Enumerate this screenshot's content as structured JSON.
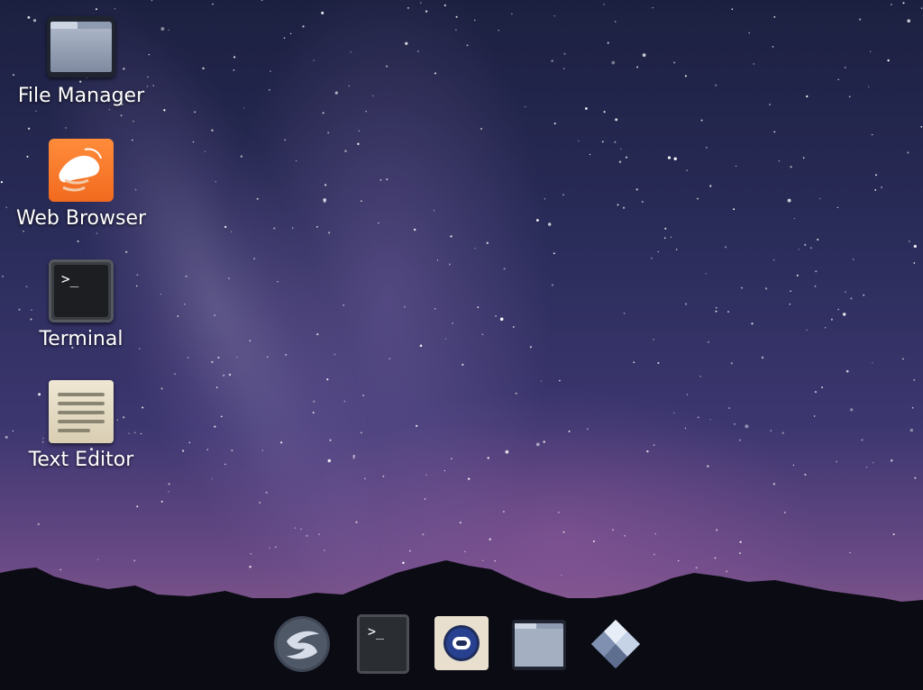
{
  "desktop": {
    "icons": [
      {
        "label": "File Manager",
        "icon": "folder-icon"
      },
      {
        "label": "Web Browser",
        "icon": "web-browser-icon"
      },
      {
        "label": "Terminal",
        "icon": "terminal-icon"
      },
      {
        "label": "Text Editor",
        "icon": "text-editor-icon"
      }
    ],
    "terminal_prompt": ">_"
  },
  "dock": {
    "items": [
      {
        "icon": "launcher-icon"
      },
      {
        "icon": "terminal-icon"
      },
      {
        "icon": "browser-icon"
      },
      {
        "icon": "folder-icon"
      },
      {
        "icon": "diamond-app-icon"
      }
    ]
  },
  "colors": {
    "sky_top": "#1c2040",
    "sky_mid": "#3d3770",
    "horizon": "#7b5488",
    "mountains": "#0b0b14",
    "browser_orange": "#f26a1f"
  }
}
